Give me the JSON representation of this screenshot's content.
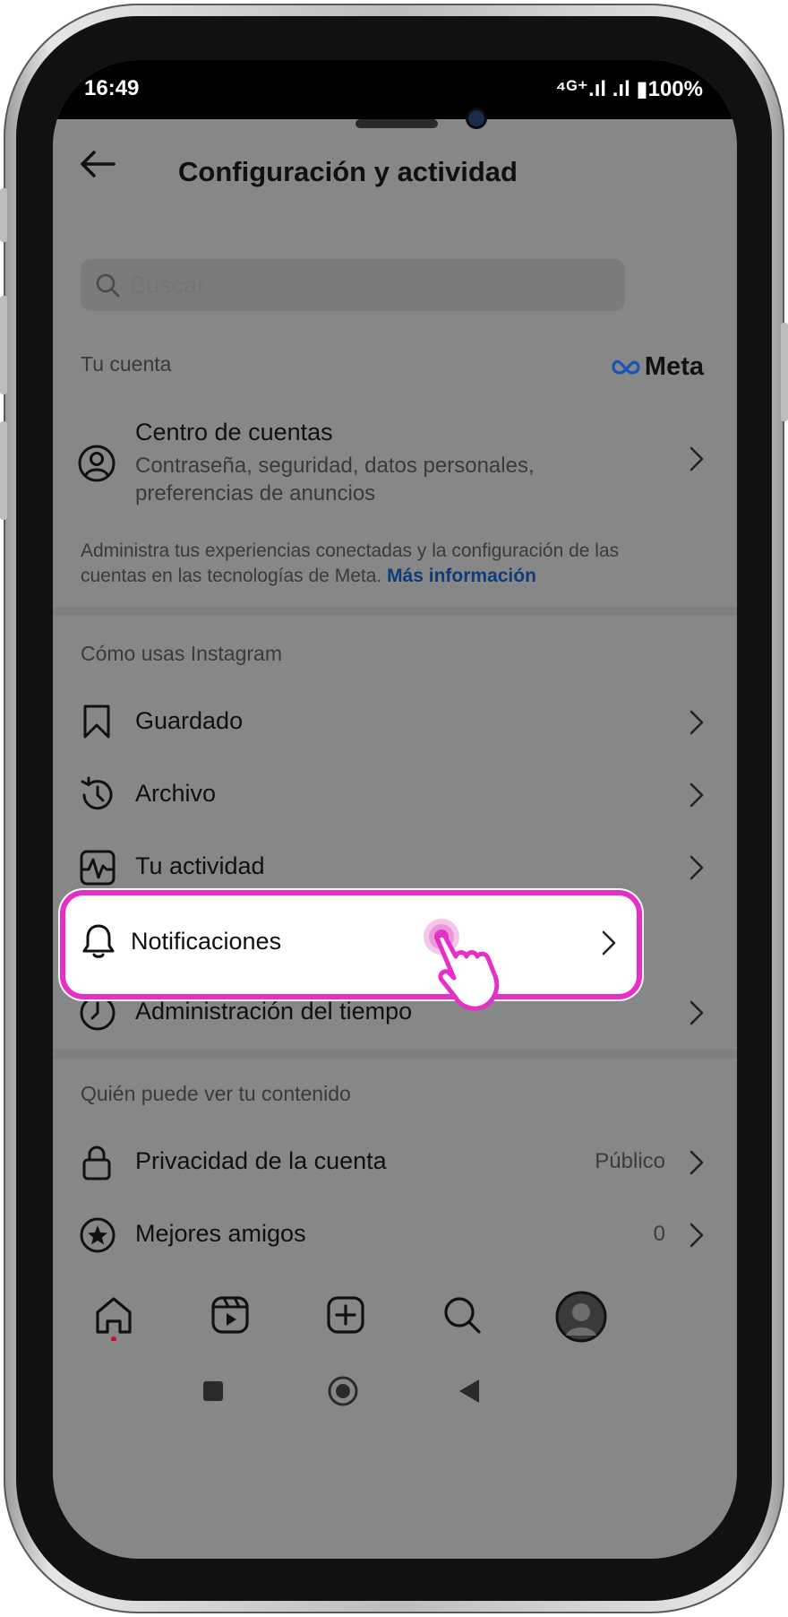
{
  "status": {
    "time": "16:49",
    "right": "⁴ᴳ⁺.ıl .ıl ▮100%"
  },
  "header": {
    "title": "Configuración y actividad"
  },
  "search": {
    "placeholder": "Buscar"
  },
  "account_section": {
    "label": "Tu cuenta",
    "brand": "Meta",
    "account_center": {
      "title": "Centro de cuentas",
      "subtitle": "Contraseña, seguridad, datos personales, preferencias de anuncios"
    },
    "info_text": "Administra tus experiencias conectadas y la configuración de las cuentas en las tecnologías de Meta.",
    "info_link": "Más información"
  },
  "usage_section": {
    "label": "Cómo usas Instagram",
    "items": [
      {
        "label": "Guardado",
        "icon": "bookmark-icon"
      },
      {
        "label": "Archivo",
        "icon": "archive-history-icon"
      },
      {
        "label": "Tu actividad",
        "icon": "activity-icon"
      },
      {
        "label": "Notificaciones",
        "icon": "bell-icon"
      },
      {
        "label": "Administración del tiempo",
        "icon": "clock-icon"
      }
    ]
  },
  "visibility_section": {
    "label": "Quién puede ver tu contenido",
    "items": [
      {
        "label": "Privacidad de la cuenta",
        "value": "Público",
        "icon": "lock-icon"
      },
      {
        "label": "Mejores amigos",
        "value": "0",
        "icon": "star-circle-icon"
      }
    ]
  },
  "bottom_nav": [
    "home-icon",
    "reels-icon",
    "create-icon",
    "search-icon",
    "profile-avatar"
  ],
  "colors": {
    "overlay": "#878787",
    "highlight_border": "#e42fc8",
    "link": "#0d3b7a"
  }
}
